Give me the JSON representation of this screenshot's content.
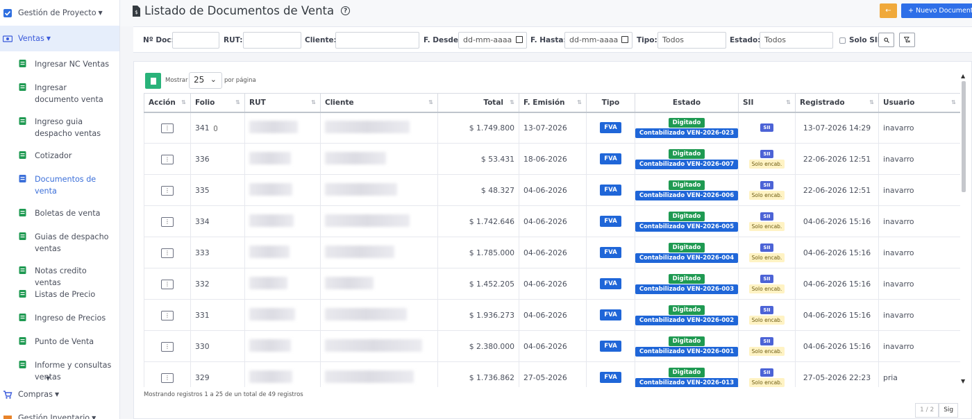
{
  "sidebar": {
    "project": "Gestión de Proyecto",
    "ventas": "Ventas",
    "items": [
      {
        "label": "Ingresar NC Ventas",
        "icon": "file-excel-icon"
      },
      {
        "label": "Ingresar documento venta",
        "icon": "file-signature-icon"
      },
      {
        "label": "Ingreso guia despacho ventas",
        "icon": "truck-icon"
      },
      {
        "label": "Cotizador",
        "icon": "calculator-icon"
      },
      {
        "label": "Documentos de venta",
        "icon": "file-icon"
      },
      {
        "label": "Boletas de venta",
        "icon": "receipt-icon"
      },
      {
        "label": "Guias de despacho ventas",
        "icon": "truck-icon"
      },
      {
        "label": "Notas credito ventas",
        "icon": "file-invoice-icon"
      },
      {
        "label": "Listas de Precio",
        "icon": "list-icon"
      },
      {
        "label": "Ingreso de Precios",
        "icon": "list-icon"
      },
      {
        "label": "Punto de Venta",
        "icon": "cash-register-icon"
      },
      {
        "label": "Informe y consultas ventas",
        "icon": "chart-icon"
      }
    ],
    "compras": "Compras",
    "inventario": "Gestión Inventario"
  },
  "header": {
    "title": "Listado de Documentos de Venta",
    "back_label": "←",
    "new_label": "+ Nuevo Documento"
  },
  "filters": {
    "ndoc_label": "Nº Doc:",
    "rut_label": "RUT:",
    "cliente_label": "Cliente:",
    "desde_label": "F. Desde:",
    "desde_placeholder": "dd-mm-aaaa",
    "hasta_label": "F. Hasta:",
    "hasta_placeholder": "dd-mm-aaaa",
    "tipo_label": "Tipo:",
    "tipo_value": "Todos",
    "estado_label": "Estado:",
    "estado_value": "Todos",
    "solo_sii_label": "Solo SII"
  },
  "table_controls": {
    "mostrar": "Mostrar",
    "page_size": "25",
    "por_pagina": "por página"
  },
  "columns": [
    "Acción",
    "Folio",
    "RUT",
    "Cliente",
    "Total",
    "F. Emisión",
    "Tipo",
    "Estado",
    "SII",
    "Registrado",
    "Usuario"
  ],
  "rows": [
    {
      "folio": "341",
      "attachment": true,
      "total": "$ 1.749.800",
      "emision": "13-07-2026",
      "tipo": "FVA",
      "estado1": "Digitado",
      "estado2": "Contabilizado VEN-2026-023",
      "sii": "SII",
      "solo": "",
      "registrado": "13-07-2026 14:29",
      "usuario": "inavarro"
    },
    {
      "folio": "336",
      "attachment": false,
      "total": "$ 53.431",
      "emision": "18-06-2026",
      "tipo": "FVA",
      "estado1": "Digitado",
      "estado2": "Contabilizado VEN-2026-007",
      "sii": "SII",
      "solo": "Solo encab.",
      "registrado": "22-06-2026 12:51",
      "usuario": "inavarro"
    },
    {
      "folio": "335",
      "attachment": false,
      "total": "$ 48.327",
      "emision": "04-06-2026",
      "tipo": "FVA",
      "estado1": "Digitado",
      "estado2": "Contabilizado VEN-2026-006",
      "sii": "SII",
      "solo": "Solo encab.",
      "registrado": "22-06-2026 12:51",
      "usuario": "inavarro"
    },
    {
      "folio": "334",
      "attachment": false,
      "total": "$ 1.742.646",
      "emision": "04-06-2026",
      "tipo": "FVA",
      "estado1": "Digitado",
      "estado2": "Contabilizado VEN-2026-005",
      "sii": "SII",
      "solo": "Solo encab.",
      "registrado": "04-06-2026 15:16",
      "usuario": "inavarro"
    },
    {
      "folio": "333",
      "attachment": false,
      "total": "$ 1.785.000",
      "emision": "04-06-2026",
      "tipo": "FVA",
      "estado1": "Digitado",
      "estado2": "Contabilizado VEN-2026-004",
      "sii": "SII",
      "solo": "Solo encab.",
      "registrado": "04-06-2026 15:16",
      "usuario": "inavarro"
    },
    {
      "folio": "332",
      "attachment": false,
      "total": "$ 1.452.205",
      "emision": "04-06-2026",
      "tipo": "FVA",
      "estado1": "Digitado",
      "estado2": "Contabilizado VEN-2026-003",
      "sii": "SII",
      "solo": "Solo encab.",
      "registrado": "04-06-2026 15:16",
      "usuario": "inavarro"
    },
    {
      "folio": "331",
      "attachment": false,
      "total": "$ 1.936.273",
      "emision": "04-06-2026",
      "tipo": "FVA",
      "estado1": "Digitado",
      "estado2": "Contabilizado VEN-2026-002",
      "sii": "SII",
      "solo": "Solo encab.",
      "registrado": "04-06-2026 15:16",
      "usuario": "inavarro"
    },
    {
      "folio": "330",
      "attachment": false,
      "total": "$ 2.380.000",
      "emision": "04-06-2026",
      "tipo": "FVA",
      "estado1": "Digitado",
      "estado2": "Contabilizado VEN-2026-001",
      "sii": "SII",
      "solo": "Solo encab.",
      "registrado": "04-06-2026 15:16",
      "usuario": "inavarro"
    },
    {
      "folio": "329",
      "attachment": false,
      "total": "$ 1.736.862",
      "emision": "27-05-2026",
      "tipo": "FVA",
      "estado1": "Digitado",
      "estado2": "Contabilizado VEN-2026-013",
      "sii": "SII",
      "solo": "Solo encab.",
      "registrado": "27-05-2026 22:23",
      "usuario": "pria"
    }
  ],
  "footer": {
    "info": "Mostrando registros 1 a 25 de un total de 49 registros",
    "page": "1 / 2",
    "next": "Sig"
  },
  "colors": {
    "primary": "#2e6fe8",
    "success": "#1f9a52",
    "warning": "#f0a93b",
    "excel": "#29b37a"
  }
}
